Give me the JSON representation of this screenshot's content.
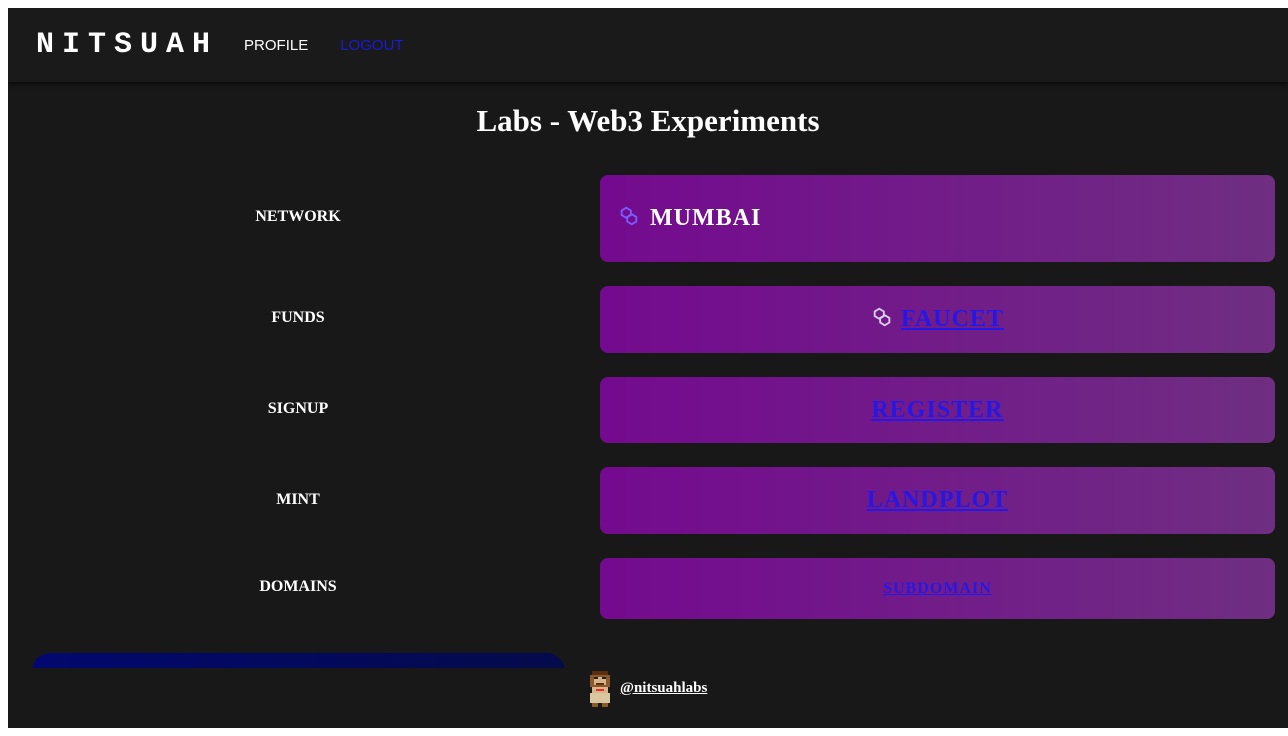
{
  "header": {
    "brand": "NITSUAH",
    "nav": {
      "profile": "PROFILE",
      "logout": "LOGOUT"
    }
  },
  "page": {
    "title": "Labs - Web3 Experiments"
  },
  "rows": [
    {
      "label": "NETWORK",
      "value": "MUMBAI",
      "icon": "polygon-icon"
    },
    {
      "label": "FUNDS",
      "link": "FAUCET",
      "icon": "polygon-icon"
    },
    {
      "label": "SIGNUP",
      "link": "REGISTER"
    },
    {
      "label": "MINT",
      "link": "LANDPLOT"
    },
    {
      "label": "DOMAINS",
      "link": "SUBDOMAIN"
    }
  ],
  "footer": {
    "handle": "@nitsuahlabs",
    "avatar_icon": "pixel-ape-avatar"
  },
  "colors": {
    "background": "#181818",
    "card_start": "#740a8f",
    "card_end": "#6f2e82",
    "link": "#2318e8",
    "logout": "#1a1ad8",
    "panel": "#02086e"
  }
}
